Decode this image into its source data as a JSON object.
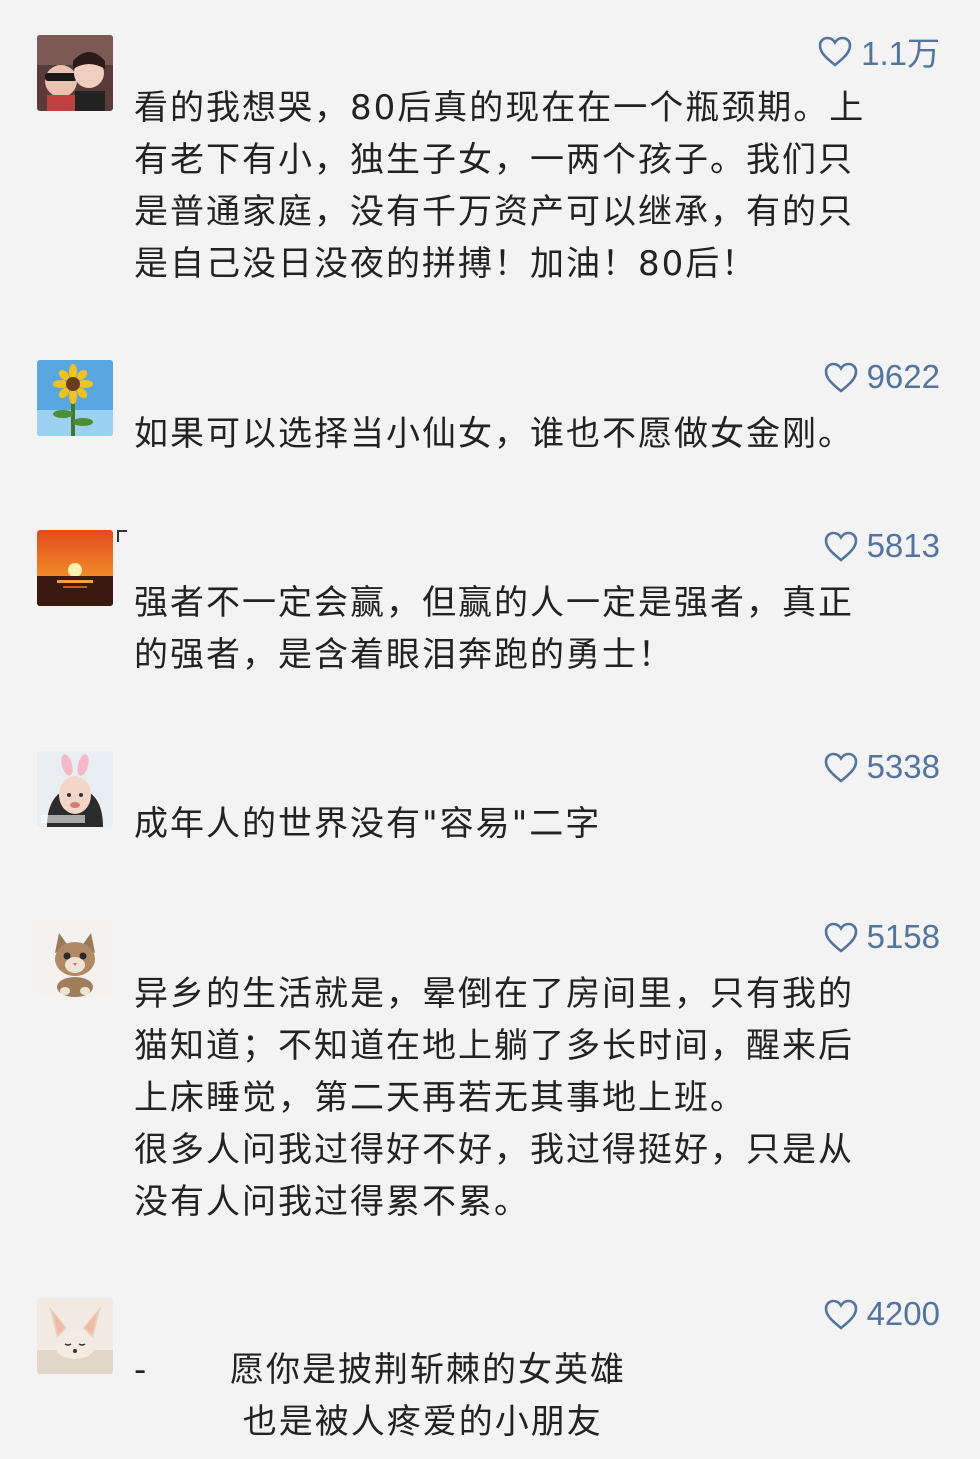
{
  "comments": [
    {
      "likes": "1.1万",
      "text": "看的我想哭，80后真的现在在一个瓶颈期。上\n有老下有小，独生子女，一两个孩子。我们只\n是普通家庭，没有千万资产可以继承，有的只\n是自己没日没夜的拼搏！加油！80后！",
      "avatar": "couple-photo"
    },
    {
      "likes": "9622",
      "text": "如果可以选择当小仙女，谁也不愿做女金刚。",
      "avatar": "sunflower-photo"
    },
    {
      "likes": "5813",
      "text": "强者不一定会赢，但赢的人一定是强者，真正\n的强者，是含着眼泪奔跑的勇士！",
      "avatar": "sunset-photo"
    },
    {
      "likes": "5338",
      "text": "成年人的世界没有\"容易\"二字",
      "avatar": "girl-bunny-ears-photo"
    },
    {
      "likes": "5158",
      "text": "异乡的生活就是，晕倒在了房间里，只有我的\n猫知道；不知道在地上躺了多长时间，醒来后\n上床睡觉，第二天再若无其事地上班。\n很多人问我过得好不好，我过得挺好，只是从\n没有人问我过得累不累。",
      "avatar": "kitten-photo"
    },
    {
      "likes": "4200",
      "dash": "-",
      "lines": [
        "愿你是披荆斩棘的女英雄",
        " 也是被人疼爱的小朋友"
      ],
      "avatar": "fox-photo"
    }
  ],
  "colors": {
    "background": "#f3f3f3",
    "like_color": "#53749d",
    "text": "#222222"
  },
  "icons": {
    "like": "heart-outline-icon"
  }
}
